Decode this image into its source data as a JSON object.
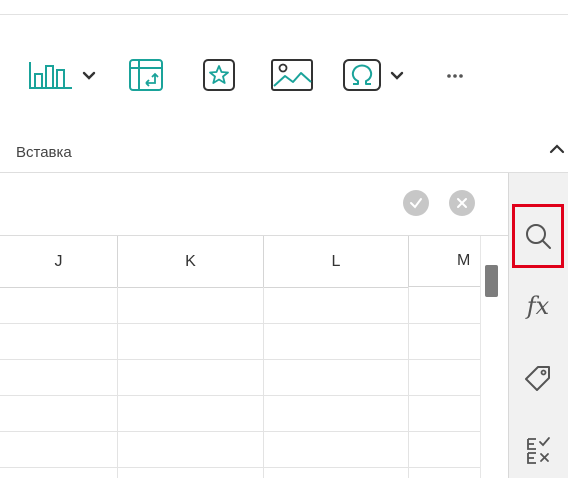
{
  "ribbon": {
    "section_label": "Вставка",
    "tools": [
      {
        "name": "chart",
        "icon": "bar-chart-icon",
        "dropdown": true
      },
      {
        "name": "pivot-table",
        "icon": "pivot-table-icon",
        "dropdown": false
      },
      {
        "name": "shape",
        "icon": "star-shape-icon",
        "dropdown": false
      },
      {
        "name": "image",
        "icon": "image-icon",
        "dropdown": false
      },
      {
        "name": "symbol",
        "icon": "omega-symbol-icon",
        "dropdown": true
      },
      {
        "name": "more",
        "icon": "more-icon",
        "dropdown": false
      }
    ],
    "accent_color": "#1aa39a"
  },
  "formula_bar": {
    "confirm_icon": "check-icon",
    "cancel_icon": "close-icon"
  },
  "sheet": {
    "columns": [
      "J",
      "K",
      "L",
      "M"
    ]
  },
  "side_panel": {
    "items": [
      {
        "name": "search",
        "icon": "search-icon",
        "highlighted": true
      },
      {
        "name": "functions",
        "label": "fx",
        "icon": "function-icon"
      },
      {
        "name": "tags",
        "icon": "tag-icon"
      },
      {
        "name": "formulas",
        "icon": "checklist-icon"
      }
    ],
    "highlight_color": "#e0001a"
  }
}
